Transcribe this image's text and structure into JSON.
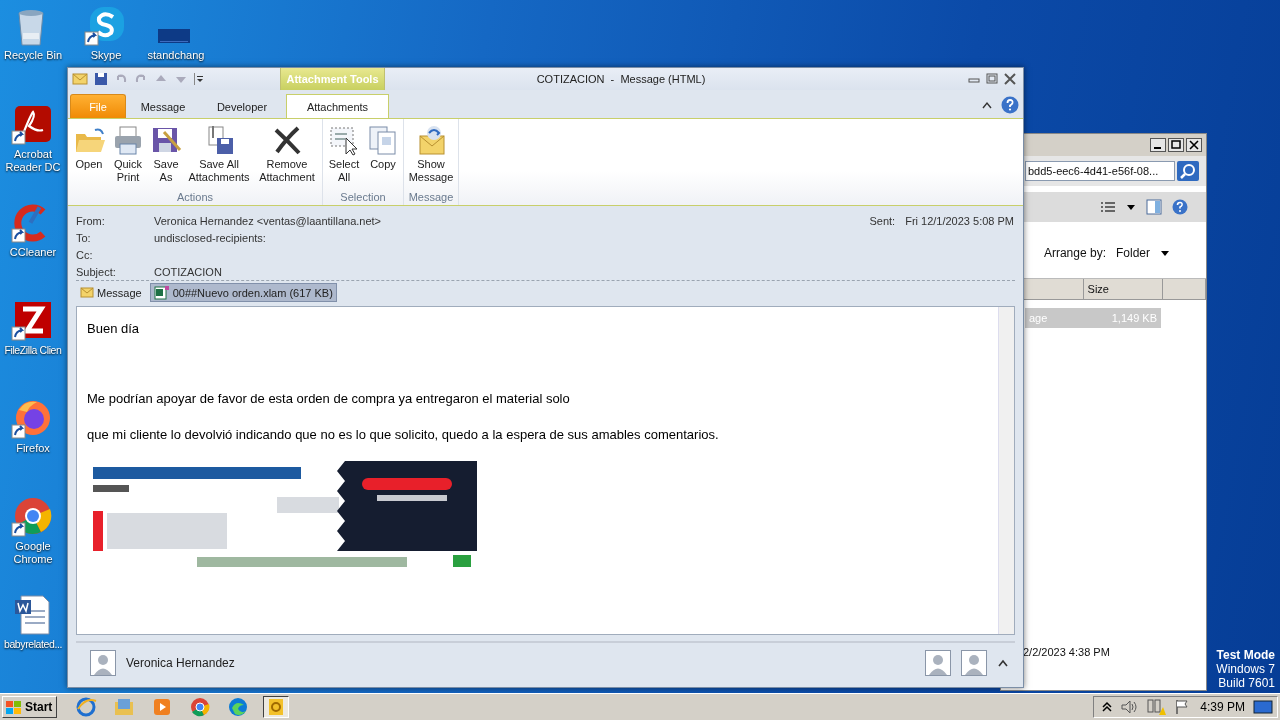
{
  "desktop_icons": [
    {
      "label": "Recycle Bin",
      "kind": "recycle-bin",
      "shortcut": false
    },
    {
      "label": "Skype",
      "kind": "skype",
      "shortcut": true
    },
    {
      "label": "standchang",
      "kind": "blank",
      "shortcut": false
    },
    {
      "label": "Acrobat Reader DC",
      "kind": "acrobat",
      "shortcut": true
    },
    {
      "label": "CCleaner",
      "kind": "ccleaner",
      "shortcut": true
    },
    {
      "label": "FileZilla Clien",
      "kind": "filezilla",
      "shortcut": true
    },
    {
      "label": "Firefox",
      "kind": "firefox",
      "shortcut": true
    },
    {
      "label": "Google Chrome",
      "kind": "chrome",
      "shortcut": true
    },
    {
      "label": "babyrelated...",
      "kind": "word",
      "shortcut": false
    }
  ],
  "message_window": {
    "title": "COTIZACION  -  Message (HTML)",
    "contextual_group": "Attachment Tools",
    "tabs": [
      {
        "label": "File",
        "kind": "file",
        "selected": false
      },
      {
        "label": "Message",
        "kind": "tab",
        "selected": false
      },
      {
        "label": "Developer",
        "kind": "tab",
        "selected": false
      },
      {
        "label": "Attachments",
        "kind": "tab",
        "selected": true
      }
    ],
    "ribbon_groups": [
      {
        "label": "Actions",
        "buttons": [
          {
            "label": "Open",
            "kind": "open"
          },
          {
            "label": "Quick Print",
            "kind": "print"
          },
          {
            "label": "Save As",
            "kind": "save-as"
          },
          {
            "label": "Save All Attachments",
            "kind": "save-all"
          },
          {
            "label": "Remove Attachment",
            "kind": "remove"
          }
        ]
      },
      {
        "label": "Selection",
        "buttons": [
          {
            "label": "Select All",
            "kind": "select-all"
          },
          {
            "label": "Copy",
            "kind": "copy"
          }
        ]
      },
      {
        "label": "Message",
        "buttons": [
          {
            "label": "Show Message",
            "kind": "show-message"
          }
        ]
      }
    ],
    "header": {
      "fields": [
        {
          "label": "From:",
          "value": "Veronica Hernandez <ventas@laantillana.net>"
        },
        {
          "label": "To:",
          "value": "undisclosed-recipients:"
        },
        {
          "label": "Cc:"
        },
        {
          "label": "Subject:",
          "value": "COTIZACION"
        }
      ],
      "sent": {
        "label": "Sent:",
        "value": "Fri 12/1/2023 5:08 PM"
      }
    },
    "attachments": [
      {
        "label": "Message",
        "kind": "message",
        "selected": false
      },
      {
        "label": "00##Nuevo orden.xlam (617 KB)",
        "kind": "excel",
        "selected": true
      }
    ],
    "body": [
      "Buen día",
      "Me podrían apoyar de favor de esta orden de compra ya entregaron el material solo",
      "que mi cliente lo devolvió indicando que no es lo que solicito, quedo a la espera de sus amables comentarios."
    ],
    "signature": {
      "kind": "picture"
    },
    "sender": "Veronica Hernandez"
  },
  "background_window": {
    "search_value": "bdd5-eec6-4d41-e56f-08...",
    "arrange_label": "Arrange by:",
    "arrange_value": "Folder",
    "column": "Size",
    "row": {
      "name": "age",
      "size": "1,149 KB",
      "selected": true
    },
    "date": "2/2/2023 4:38 PM"
  },
  "test_mode": [
    "Test Mode",
    "Windows 7",
    "Build 7601"
  ],
  "taskbar": {
    "start": "Start",
    "apps": [
      {
        "kind": "ie",
        "selected": false
      },
      {
        "kind": "explorer",
        "selected": false
      },
      {
        "kind": "media",
        "selected": false
      },
      {
        "kind": "chrome",
        "selected": false
      },
      {
        "kind": "edge",
        "selected": false
      },
      {
        "kind": "outlook",
        "selected": true
      }
    ],
    "clock": "4:39 PM"
  }
}
